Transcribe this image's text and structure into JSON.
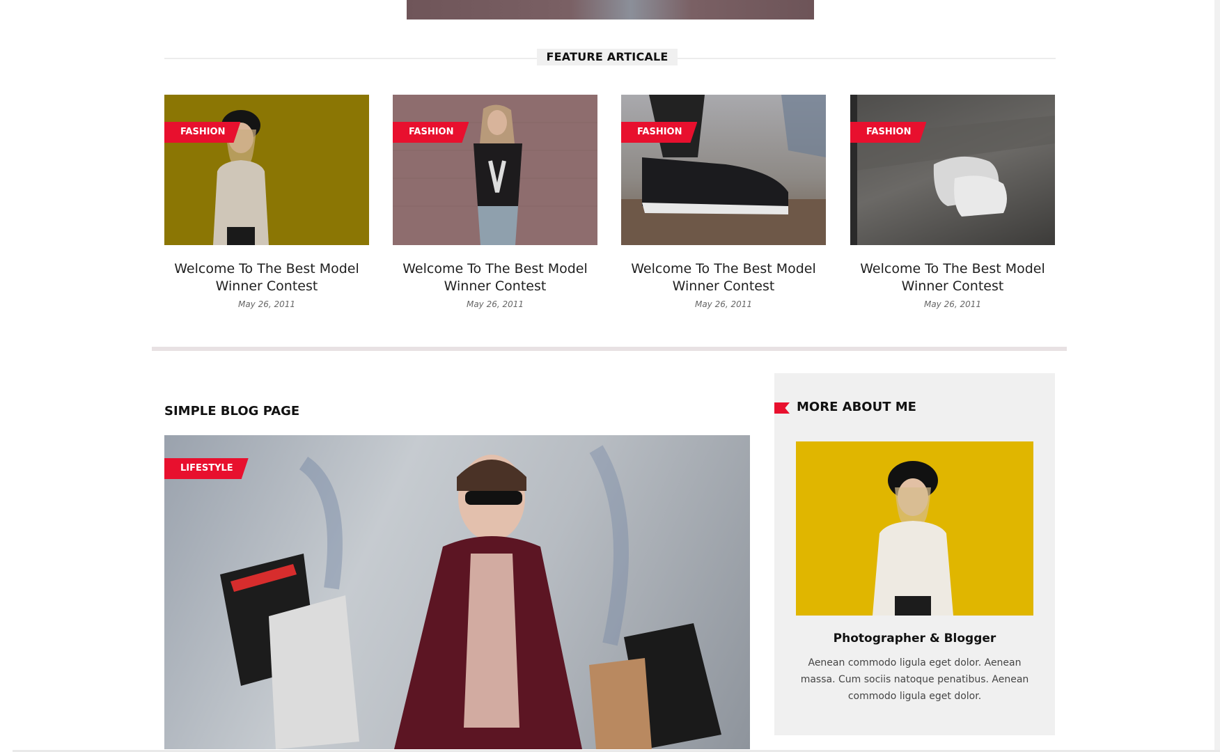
{
  "feature": {
    "title": "FEATURE ARTICALE",
    "cards": [
      {
        "badge": "FASHION",
        "title": "Welcome To The Best Model Winner Contest",
        "date": "May 26, 2011"
      },
      {
        "badge": "FASHION",
        "title": "Welcome To The Best Model Winner Contest",
        "date": "May 26, 2011"
      },
      {
        "badge": "FASHION",
        "title": "Welcome To The Best Model Winner Contest",
        "date": "May 26, 2011"
      },
      {
        "badge": "FASHION",
        "title": "Welcome To The Best Model Winner Contest",
        "date": "May 26, 2011"
      }
    ]
  },
  "blog": {
    "title": "SIMPLE BLOG PAGE",
    "badge": "LIFESTYLE"
  },
  "sidebar": {
    "title": "MORE ABOUT ME",
    "role": "Photographer & Blogger",
    "text": "Aenean commodo ligula eget dolor. Aenean massa. Cum sociis natoque penatibus. Aenean commodo ligula eget dolor."
  },
  "colors": {
    "accent": "#e8102e"
  }
}
